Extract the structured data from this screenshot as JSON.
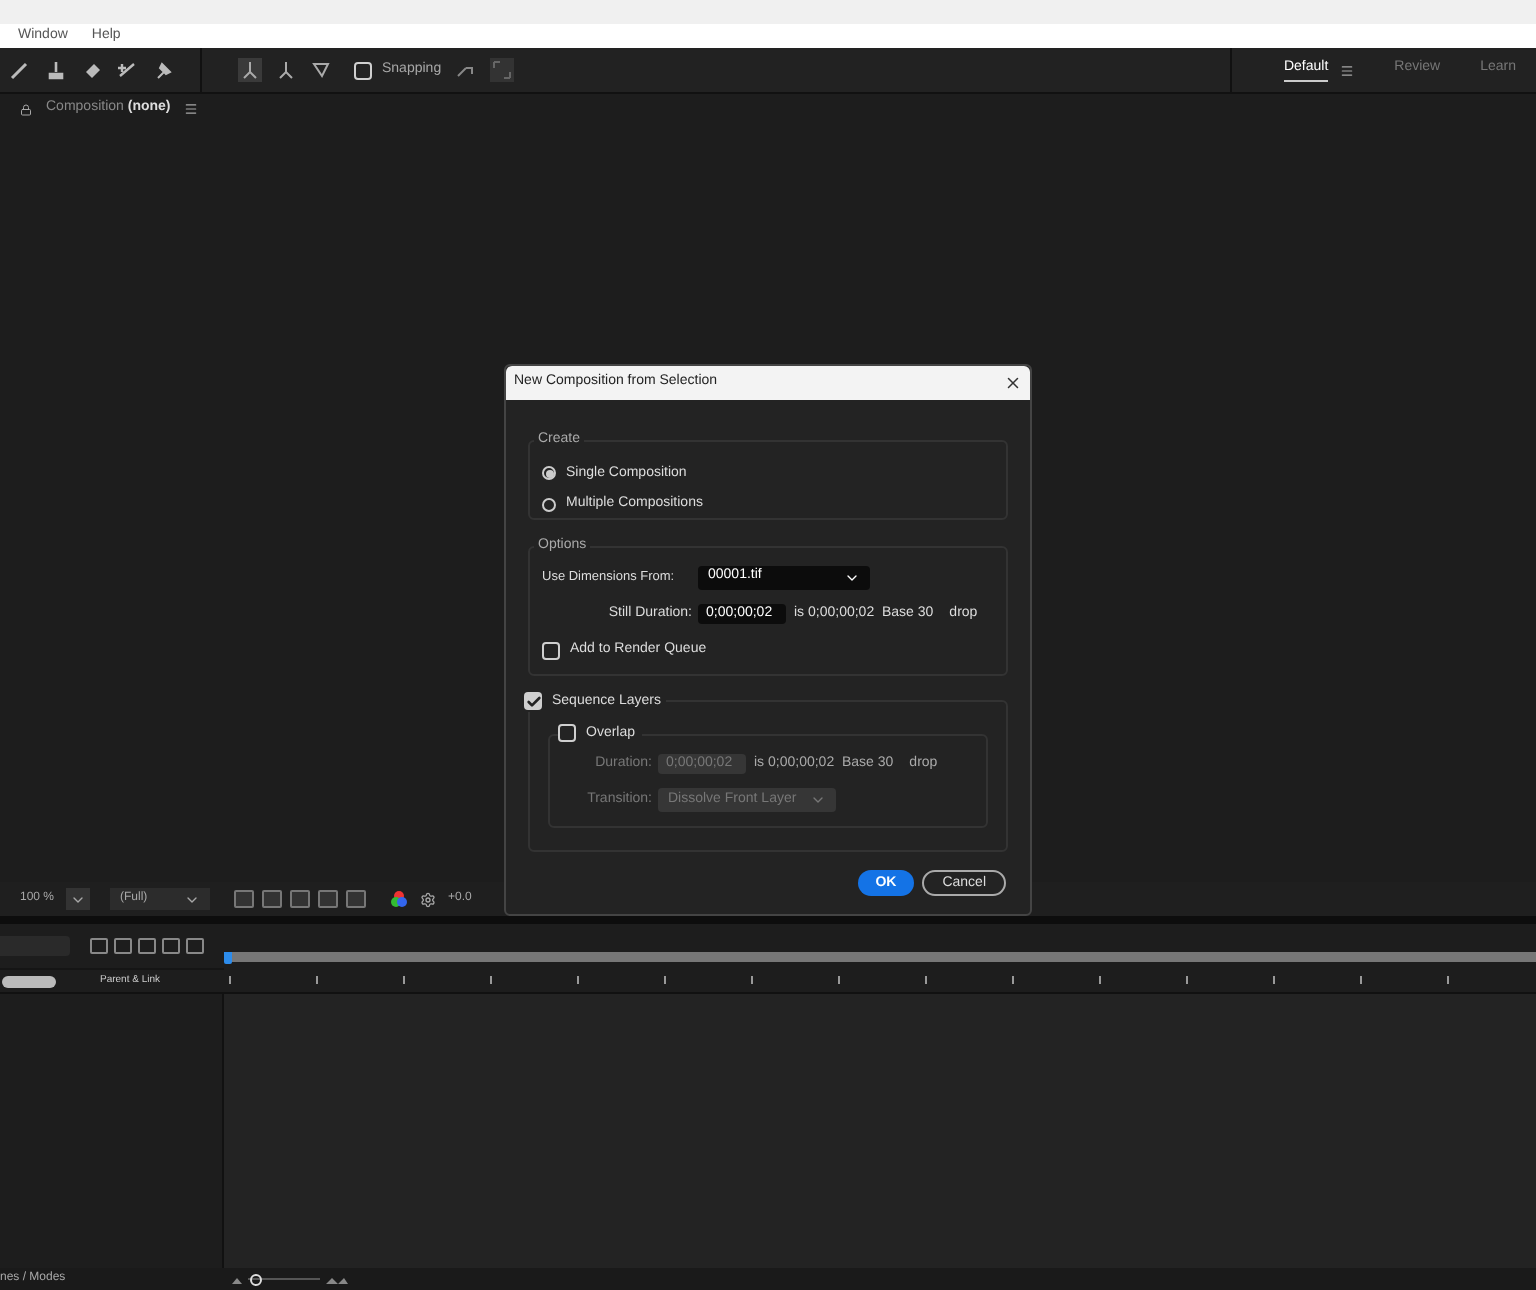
{
  "menu": [
    "Window",
    "Help"
  ],
  "toolbar": {
    "snapping": {
      "label": "Snapping",
      "checked": false
    }
  },
  "workspaces": [
    {
      "label": "Default",
      "selected": true
    },
    {
      "label": "Review",
      "selected": false
    },
    {
      "label": "Learn",
      "selected": false
    }
  ],
  "composition_panel": {
    "title": "Composition",
    "value": "(none)"
  },
  "viewer_bar": {
    "zoom": "100 %",
    "resolution": "(Full)",
    "exposure": "+0.0"
  },
  "timeline": {
    "column": "Parent & Link",
    "footer": "nes / Modes",
    "zoom_slider": {
      "level": 0.05
    }
  },
  "dialog": {
    "title": "New Composition from Selection",
    "create": {
      "legend": "Create",
      "options": [
        {
          "label": "Single Composition",
          "selected": true
        },
        {
          "label": "Multiple Compositions",
          "selected": false
        }
      ]
    },
    "options": {
      "legend": "Options",
      "dimensions_label": "Use Dimensions From:",
      "dimensions_value": "00001.tif",
      "still_label": "Still Duration:",
      "still_value": "0;00;00;02",
      "still_info": "is 0;00;00;02  Base 30",
      "still_drop": "drop",
      "render_queue": {
        "label": "Add to Render Queue",
        "checked": false
      }
    },
    "sequence": {
      "label": "Sequence Layers",
      "checked": true,
      "overlap": {
        "label": "Overlap",
        "checked": false
      },
      "duration_label": "Duration:",
      "duration_value": "0;00;00;02",
      "duration_info": "is 0;00;00;02  Base 30",
      "duration_drop": "drop",
      "transition_label": "Transition:",
      "transition_value": "Dissolve Front Layer"
    },
    "buttons": [
      {
        "label": "OK",
        "kind": "primary"
      },
      {
        "label": "Cancel",
        "kind": "secondary"
      }
    ]
  }
}
